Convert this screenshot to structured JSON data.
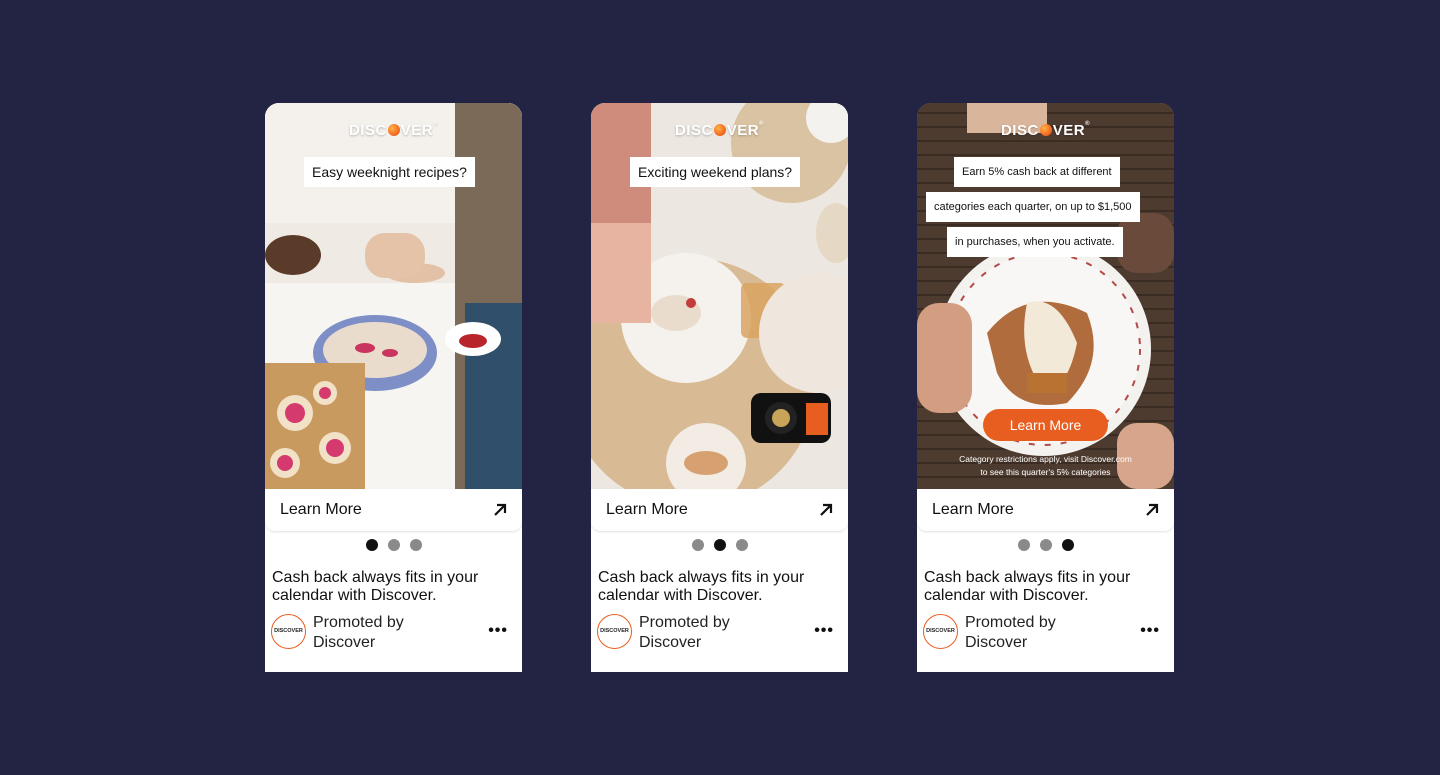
{
  "colors": {
    "background": "#232444",
    "accent": "#e85e21",
    "dot_active": "#111111",
    "dot_inactive": "#8a8a8a"
  },
  "cards": [
    {
      "brand": {
        "pre": "DISC",
        "post": "VER"
      },
      "captions": [
        "Easy weeknight recipes?"
      ],
      "learn_more": "Learn More",
      "active_slide": 1,
      "headline": "Cash back always fits in your calendar with Discover.",
      "promoted_line1": "Promoted by",
      "promoted_line2": "Discover",
      "avatar_text": "DISCOVER"
    },
    {
      "brand": {
        "pre": "DISC",
        "post": "VER"
      },
      "captions": [
        "Exciting weekend plans?"
      ],
      "learn_more": "Learn More",
      "active_slide": 2,
      "headline": "Cash back always fits in your calendar with Discover.",
      "promoted_line1": "Promoted by",
      "promoted_line2": "Discover",
      "avatar_text": "DISCOVER"
    },
    {
      "brand": {
        "pre": "DISC",
        "post": "VER"
      },
      "captions": [
        "Earn 5% cash back at different",
        "categories each quarter, on up to $1,500",
        "in purchases, when you activate."
      ],
      "cta_button": "Learn More",
      "fineprint_line1": "Category restrictions apply, visit Discover.com",
      "fineprint_line2": "to see this quarter's 5% categories",
      "learn_more": "Learn More",
      "active_slide": 3,
      "headline": "Cash back always fits in your calendar with Discover.",
      "promoted_line1": "Promoted by",
      "promoted_line2": "Discover",
      "avatar_text": "DISCOVER"
    }
  ]
}
